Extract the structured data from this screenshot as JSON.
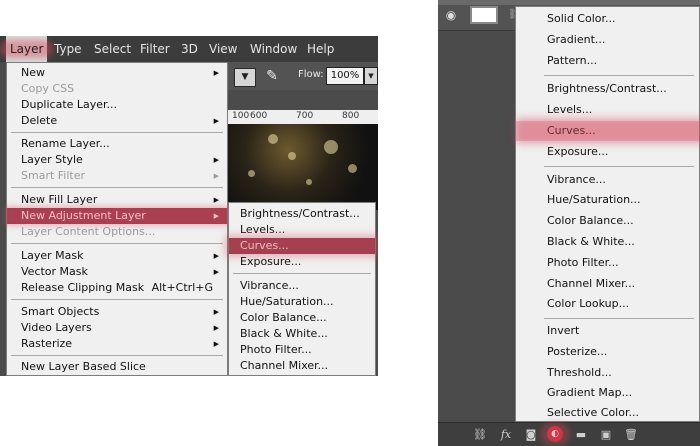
{
  "menubar": {
    "items": [
      "Layer",
      "Type",
      "Select",
      "Filter",
      "3D",
      "View",
      "Window",
      "Help"
    ]
  },
  "toolbar": {
    "flow_label": "Flow:",
    "flow_value": "100%"
  },
  "ruler": {
    "ticks": [
      "100",
      "600",
      "700",
      "800"
    ]
  },
  "layer_menu": {
    "items": [
      {
        "label": "New",
        "submenu": true
      },
      {
        "label": "Copy CSS",
        "disabled": true
      },
      {
        "label": "Duplicate Layer..."
      },
      {
        "label": "Delete",
        "submenu": true
      },
      {
        "label": "Rename Layer..."
      },
      {
        "label": "Layer Style",
        "submenu": true
      },
      {
        "label": "Smart Filter",
        "submenu": true,
        "disabled": true
      },
      {
        "label": "New Fill Layer",
        "submenu": true
      },
      {
        "label": "New Adjustment Layer",
        "submenu": true,
        "highlighted": true
      },
      {
        "label": "Layer Content Options...",
        "disabled": true
      },
      {
        "label": "Layer Mask",
        "submenu": true
      },
      {
        "label": "Vector Mask",
        "submenu": true
      },
      {
        "label": "Release Clipping Mask",
        "shortcut": "Alt+Ctrl+G"
      },
      {
        "label": "Smart Objects",
        "submenu": true
      },
      {
        "label": "Video Layers",
        "submenu": true
      },
      {
        "label": "Rasterize",
        "submenu": true
      },
      {
        "label": "New Layer Based Slice"
      }
    ]
  },
  "adjustment_submenu": {
    "items": [
      {
        "label": "Brightness/Contrast..."
      },
      {
        "label": "Levels..."
      },
      {
        "label": "Curves...",
        "highlighted": true
      },
      {
        "label": "Exposure..."
      },
      {
        "label": "Vibrance..."
      },
      {
        "label": "Hue/Saturation..."
      },
      {
        "label": "Color Balance..."
      },
      {
        "label": "Black & White..."
      },
      {
        "label": "Photo Filter..."
      },
      {
        "label": "Channel Mixer..."
      }
    ]
  },
  "adjustment_panel_menu": {
    "items": [
      {
        "label": "Solid Color..."
      },
      {
        "label": "Gradient..."
      },
      {
        "label": "Pattern..."
      },
      {
        "label": "Brightness/Contrast..."
      },
      {
        "label": "Levels..."
      },
      {
        "label": "Curves...",
        "highlighted": true
      },
      {
        "label": "Exposure..."
      },
      {
        "label": "Vibrance..."
      },
      {
        "label": "Hue/Saturation..."
      },
      {
        "label": "Color Balance..."
      },
      {
        "label": "Black & White..."
      },
      {
        "label": "Photo Filter..."
      },
      {
        "label": "Channel Mixer..."
      },
      {
        "label": "Color Lookup..."
      },
      {
        "label": "Invert"
      },
      {
        "label": "Posterize..."
      },
      {
        "label": "Threshold..."
      },
      {
        "label": "Gradient Map..."
      },
      {
        "label": "Selective Color..."
      }
    ]
  },
  "layers_panel": {
    "footer_icons": [
      "link-icon",
      "fx-icon",
      "mask-icon",
      "adjustment-layer-icon",
      "folder-icon",
      "new-layer-icon",
      "trash-icon"
    ],
    "fx_label": "fx"
  },
  "colors": {
    "highlight": "#933d4f",
    "accent_glow": "#d6465a",
    "menu_bg": "#f0f0f0",
    "app_bg": "#4b4b4b"
  }
}
